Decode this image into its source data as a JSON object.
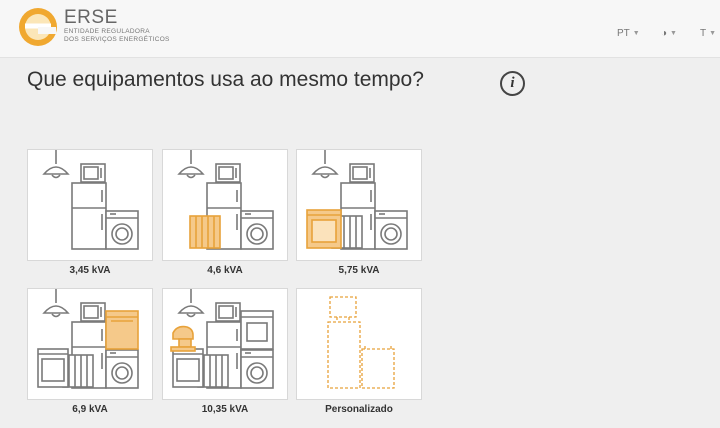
{
  "header": {
    "brand_name": "ERSE",
    "brand_sub_line1": "ENTIDADE REGULADORA",
    "brand_sub_line2": "DOS SERVIÇOS ENERGÉTICOS",
    "language": "PT",
    "contrast_icon": "◑",
    "text_size": "T"
  },
  "main": {
    "title": "Que equipamentos usa ao mesmo tempo?",
    "info_glyph": "i"
  },
  "options": [
    {
      "label": "3,45 kVA"
    },
    {
      "label": "4,6 kVA"
    },
    {
      "label": "5,75 kVA"
    },
    {
      "label": "6,9 kVA"
    },
    {
      "label": "10,35 kVA"
    },
    {
      "label": "Personalizado"
    }
  ],
  "colors": {
    "accent": "#e8a23a",
    "accent_light": "#f5c98a",
    "outline": "#7a7a7a"
  }
}
